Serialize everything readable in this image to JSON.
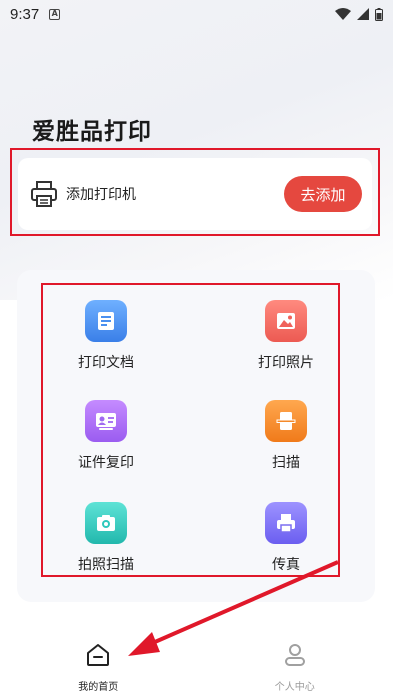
{
  "status_bar": {
    "time": "9:37",
    "a_badge": "A"
  },
  "app": {
    "title": "爱胜品打印"
  },
  "printer_card": {
    "label": "添加打印机",
    "button": "去添加"
  },
  "functions": [
    {
      "label": "打印文档",
      "icon": "document-icon",
      "color": "#4a90f0"
    },
    {
      "label": "打印照片",
      "icon": "photo-icon",
      "color": "#f0625a"
    },
    {
      "label": "证件复印",
      "icon": "id-card-icon",
      "color": "#a06af0"
    },
    {
      "label": "扫描",
      "icon": "scan-icon",
      "color": "#f58a2a"
    },
    {
      "label": "拍照扫描",
      "icon": "camera-icon",
      "color": "#2ec8bd"
    },
    {
      "label": "传真",
      "icon": "fax-icon",
      "color": "#7b6ff0"
    }
  ],
  "tabs": [
    {
      "label": "我的首页",
      "icon": "home-icon",
      "active": true
    },
    {
      "label": "个人中心",
      "icon": "profile-icon",
      "active": false
    }
  ],
  "colors": {
    "accent": "#e5483f",
    "annotation": "#e0182a"
  }
}
